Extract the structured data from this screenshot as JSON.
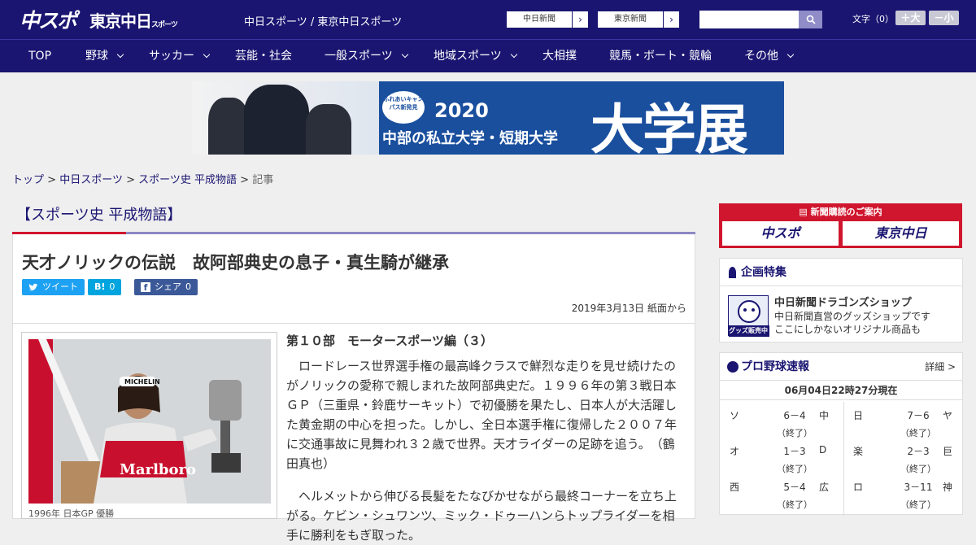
{
  "header": {
    "logo_chunichi_sports": "中スポ",
    "logo_tokyo_chunichi": "東京中日",
    "logo_tokyo_chunichi_suffix": "スポーツ",
    "site_name": "中日スポーツ / 東京中日スポーツ",
    "link_chunichi": "中日新聞",
    "link_tokyo": "東京新聞",
    "search_placeholder": "",
    "font_size_label": "文字（0）",
    "font_bigger": "＋大",
    "font_smaller": "－小"
  },
  "nav": {
    "items": [
      {
        "label": "TOP"
      },
      {
        "label": "野球"
      },
      {
        "label": "サッカー"
      },
      {
        "label": "芸能・社会"
      },
      {
        "label": "一般スポーツ"
      },
      {
        "label": "地域スポーツ"
      },
      {
        "label": "大相撲"
      },
      {
        "label": "競馬・ボート・競輪"
      },
      {
        "label": "その他"
      }
    ]
  },
  "banner": {
    "badge": "ふれあいキャンパス新発見",
    "year": "2020",
    "subtitle": "中部の私立大学・短期大学",
    "title": "大学展"
  },
  "breadcrumb": {
    "home": "トップ",
    "sep": ">",
    "level1": "中日スポーツ",
    "level2": "スポーツ史 平成物語",
    "current": "記事"
  },
  "section_title": "【スポーツ史 平成物語】",
  "article": {
    "headline": "天才ノリックの伝説　故阿部典史の息子・真生騎が継承",
    "tweet_label": "ツイート",
    "hatena_label": "B!",
    "hatena_count": "0",
    "share_label": "シェア",
    "share_count": "0",
    "date": "2019年3月13日 紙面から",
    "part": "第１０部　モータースポーツ編（３）",
    "paragraph1": "ロードレース世界選手権の最高峰クラスで鮮烈な走りを見せ続けたのがノリックの愛称で親しまれた故阿部典史だ。１９９６年の第３戦日本ＧＰ（三重県・鈴鹿サーキット）で初優勝を果たし、日本人が大活躍した黄金期の中心を担った。しかし、全日本選手権に復帰した２００７年に交通事故に見舞われ３２歳で世界。天才ライダーの足跡を追う。　（鶴田真也）",
    "paragraph2": "ヘルメットから伸びる長髪をたなびかせながら最終コーナーを立ち上がる。ケビン・シュワンツ、ミック・ドゥーハンらトップライダーを相手に勝利をもぎ取った。",
    "photo_caption": "1996年 日本GP 優勝",
    "photo_text": "Marlboro",
    "photo_text2": "MICHELIN"
  },
  "sidebar": {
    "subscribe_header": "新聞購読のご案内",
    "sub_logo1": "中スポ",
    "sub_logo2": "東京中日",
    "feature_title": "企画特集",
    "goods_title": "中日新聞ドラゴンズショップ",
    "goods_desc1": "中日新聞直営のグッズショップです",
    "goods_desc2": "ここにしかないオリジナル商品も",
    "goods_badge": "グッズ販売中",
    "baseball_title": "プロ野球速報",
    "detail_label": "詳細 >",
    "score_time": "06月04日22時27分現在",
    "games": [
      {
        "home": "ソ",
        "score": "6－4",
        "status": "（終了）",
        "away": "中"
      },
      {
        "home": "日",
        "score": "7－6",
        "status": "（終了）",
        "away": "ヤ"
      },
      {
        "home": "オ",
        "score": "1－3",
        "status": "（終了）",
        "away": "D"
      },
      {
        "home": "楽",
        "score": "2－3",
        "status": "（終了）",
        "away": "巨"
      },
      {
        "home": "西",
        "score": "5－4",
        "status": "（終了）",
        "away": "広"
      },
      {
        "home": "ロ",
        "score": "3－11",
        "status": "（終了）",
        "away": "神"
      }
    ]
  },
  "colors": {
    "brand_navy": "#1a1571",
    "accent_red": "#d0162e",
    "twitter": "#1da1f2",
    "hatena": "#00a4de",
    "facebook": "#3b5998"
  }
}
